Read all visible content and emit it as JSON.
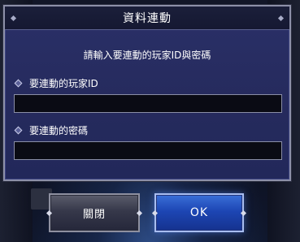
{
  "dialog": {
    "title": "資料連動",
    "instruction": "請輸入要連動的玩家ID與密碼",
    "fields": [
      {
        "label": "要連動的玩家ID",
        "value": "",
        "placeholder": ""
      },
      {
        "label": "要連動的密碼",
        "value": "",
        "placeholder": ""
      }
    ]
  },
  "buttons": {
    "close_label": "關閉",
    "ok_label": "OK"
  },
  "colors": {
    "dialog_bg": "#262b5e",
    "dialog_border": "#8d90a8",
    "ok_button": "#1d46b4",
    "close_button": "#36384a",
    "input_bg": "#0a0b14"
  },
  "icons": [
    "diamond-bullet-icon",
    "diamond-ornament-icon"
  ]
}
